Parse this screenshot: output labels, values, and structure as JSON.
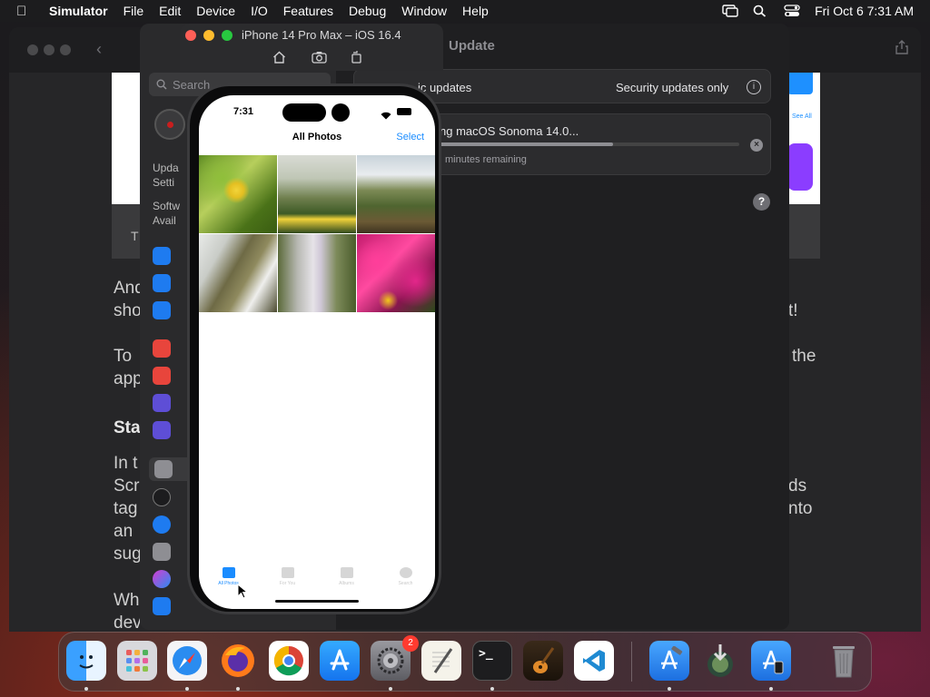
{
  "menubar": {
    "app_name": "Simulator",
    "items": [
      "File",
      "Edit",
      "Device",
      "I/O",
      "Features",
      "Debug",
      "Window",
      "Help"
    ],
    "datetime": "Fri Oct 6  7:31 AM"
  },
  "settings": {
    "title": "Update",
    "search_placeholder": "Search",
    "sidebar_partial": [
      "Upda",
      "Setti",
      "Softw",
      "Avail"
    ],
    "auto_updates_label": "ic updates",
    "auto_updates_value": "Security updates only",
    "download_label": "ng macOS Sonoma 14.0...",
    "download_progress": 0.58,
    "download_status": "minutes remaining",
    "help_label": "?"
  },
  "article": {
    "lines_left": [
      "And",
      "sho",
      "To",
      "app",
      "Sta",
      "In t",
      "Scr",
      "tag",
      "an",
      "sug",
      "Wh",
      "dev"
    ],
    "lines_right": [
      "t!",
      "the",
      "ds",
      "nto"
    ],
    "seeall": "See All",
    "banner_left": "T"
  },
  "simulator": {
    "title": "iPhone 14 Pro Max – iOS 16.4"
  },
  "phone": {
    "time": "7:31",
    "nav_title": "All Photos",
    "select_label": "Select",
    "tabs": [
      {
        "label": "All Photos",
        "active": true
      },
      {
        "label": "For You",
        "active": false
      },
      {
        "label": "Albums",
        "active": false
      },
      {
        "label": "Search",
        "active": false
      }
    ]
  },
  "dock": {
    "apps": [
      "Finder",
      "Launchpad",
      "Safari",
      "Firefox",
      "Chrome",
      "App Store",
      "System Settings",
      "TextEdit",
      "Terminal",
      "GarageBand",
      "Visual Studio Code",
      "Xcode",
      "Downloads",
      "Simulator",
      "Trash"
    ],
    "settings_badge": "2"
  }
}
